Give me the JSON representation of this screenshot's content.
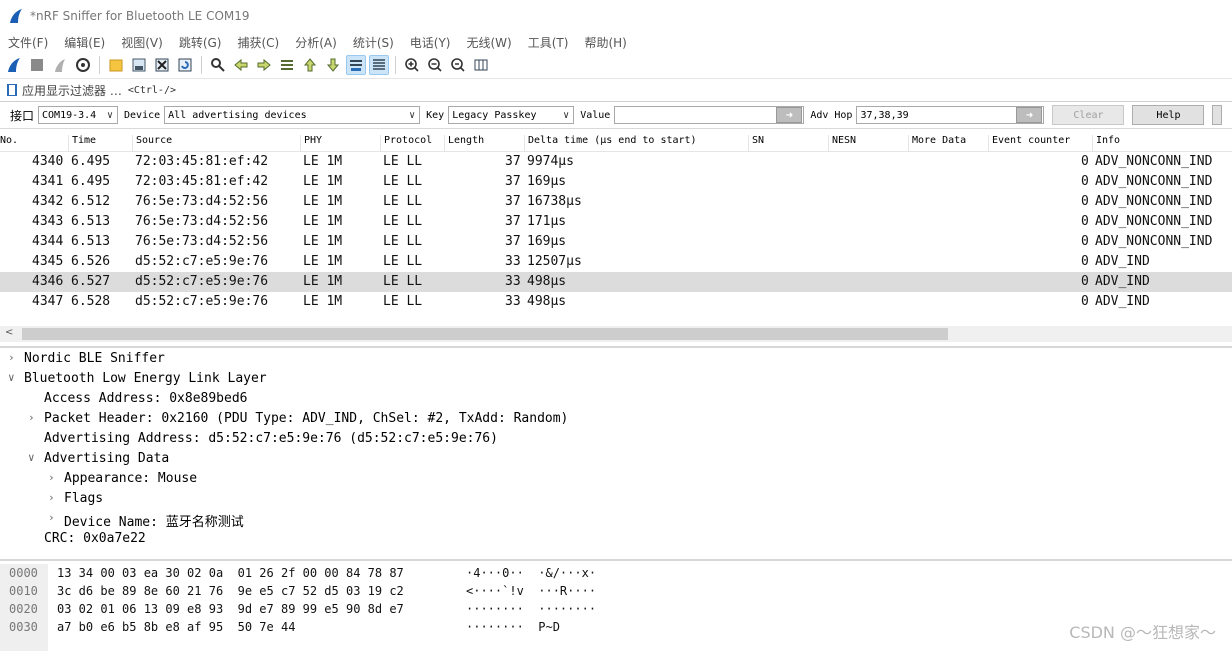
{
  "window": {
    "title": "*nRF Sniffer for Bluetooth LE COM19"
  },
  "menubar": [
    "文件(F)",
    "编辑(E)",
    "视图(V)",
    "跳转(G)",
    "捕获(C)",
    "分析(A)",
    "统计(S)",
    "电话(Y)",
    "无线(W)",
    "工具(T)",
    "帮助(H)"
  ],
  "filter": {
    "label": "应用显示过滤器 … ",
    "hint": "<Ctrl-/>"
  },
  "sniffer": {
    "interface_label": "接口",
    "interface_value": "COM19-3.4",
    "device_label": "Device",
    "device_value": "All advertising devices",
    "key_label": "Key",
    "key_value": "Legacy Passkey",
    "value_label": "Value",
    "value_value": "",
    "adv_hop_label": "Adv Hop",
    "adv_hop_value": "37,38,39",
    "clear_label": "Clear",
    "help_label": "Help"
  },
  "packet_list": {
    "columns": [
      "No.",
      "Time",
      "Source",
      "PHY",
      "Protocol",
      "Length",
      "Delta time (µs end to start)",
      "SN",
      "NESN",
      "More Data",
      "Event counter",
      "Info"
    ],
    "rows": [
      {
        "no": "4340",
        "time": "6.495",
        "source": "72:03:45:81:ef:42",
        "phy": "LE 1M",
        "protocol": "LE LL",
        "length": "37",
        "delta": "9974µs",
        "event": "0",
        "info": "ADV_NONCONN_IND"
      },
      {
        "no": "4341",
        "time": "6.495",
        "source": "72:03:45:81:ef:42",
        "phy": "LE 1M",
        "protocol": "LE LL",
        "length": "37",
        "delta": "169µs",
        "event": "0",
        "info": "ADV_NONCONN_IND"
      },
      {
        "no": "4342",
        "time": "6.512",
        "source": "76:5e:73:d4:52:56",
        "phy": "LE 1M",
        "protocol": "LE LL",
        "length": "37",
        "delta": "16738µs",
        "event": "0",
        "info": "ADV_NONCONN_IND"
      },
      {
        "no": "4343",
        "time": "6.513",
        "source": "76:5e:73:d4:52:56",
        "phy": "LE 1M",
        "protocol": "LE LL",
        "length": "37",
        "delta": "171µs",
        "event": "0",
        "info": "ADV_NONCONN_IND"
      },
      {
        "no": "4344",
        "time": "6.513",
        "source": "76:5e:73:d4:52:56",
        "phy": "LE 1M",
        "protocol": "LE LL",
        "length": "37",
        "delta": "169µs",
        "event": "0",
        "info": "ADV_NONCONN_IND"
      },
      {
        "no": "4345",
        "time": "6.526",
        "source": "d5:52:c7:e5:9e:76",
        "phy": "LE 1M",
        "protocol": "LE LL",
        "length": "33",
        "delta": "12507µs",
        "event": "0",
        "info": "ADV_IND"
      },
      {
        "no": "4346",
        "time": "6.527",
        "source": "d5:52:c7:e5:9e:76",
        "phy": "LE 1M",
        "protocol": "LE LL",
        "length": "33",
        "delta": "498µs",
        "event": "0",
        "info": "ADV_IND"
      },
      {
        "no": "4347",
        "time": "6.528",
        "source": "d5:52:c7:e5:9e:76",
        "phy": "LE 1M",
        "protocol": "LE LL",
        "length": "33",
        "delta": "498µs",
        "event": "0",
        "info": "ADV_IND"
      }
    ]
  },
  "details": [
    {
      "text": "Nordic BLE Sniffer",
      "arrow": "›"
    },
    {
      "text": "Bluetooth Low Energy Link Layer",
      "arrow": "∨"
    },
    {
      "text": "Access Address: 0x8e89bed6",
      "arrow": ""
    },
    {
      "text": "Packet Header: 0x2160 (PDU Type: ADV_IND, ChSel: #2, TxAdd: Random)",
      "arrow": "›"
    },
    {
      "text": "Advertising Address: d5:52:c7:e5:9e:76 (d5:52:c7:e5:9e:76)",
      "arrow": ""
    },
    {
      "text": "Advertising Data",
      "arrow": "∨"
    },
    {
      "text": "Appearance: Mouse",
      "arrow": "›"
    },
    {
      "text": "Flags",
      "arrow": "›"
    },
    {
      "text": "Device Name: 蓝牙名称测试",
      "arrow": "›"
    },
    {
      "text": "CRC: 0x0a7e22",
      "arrow": ""
    }
  ],
  "bytes": [
    {
      "offset": "0000",
      "hex": "13 34 00 03 ea 30 02 0a  01 26 2f 00 00 84 78 87",
      "ascii": "·4···0··  ·&/···x·"
    },
    {
      "offset": "0010",
      "hex": "3c d6 be 89 8e 60 21 76  9e e5 c7 52 d5 03 19 c2",
      "ascii": "<····`!v  ···R····"
    },
    {
      "offset": "0020",
      "hex": "03 02 01 06 13 09 e8 93  9d e7 89 99 e5 90 8d e7",
      "ascii": "········  ········"
    },
    {
      "offset": "0030",
      "hex": "a7 b0 e6 b5 8b e8 af 95  50 7e 44",
      "ascii": "········  P~D"
    }
  ],
  "watermark": "CSDN @～狂想家～"
}
